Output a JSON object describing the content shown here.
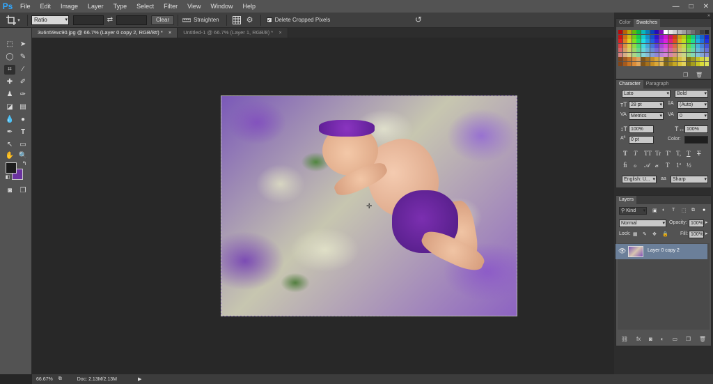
{
  "app": {
    "logo": "Ps"
  },
  "menu": [
    "File",
    "Edit",
    "Image",
    "Layer",
    "Type",
    "Select",
    "Filter",
    "View",
    "Window",
    "Help"
  ],
  "window_controls": {
    "minimize": "—",
    "maximize": "□",
    "close": "✕"
  },
  "options": {
    "tool_icon": "crop-icon",
    "ratio": "Ratio",
    "clear": "Clear",
    "straighten": "Straighten",
    "delete_cropped": "Delete Cropped Pixels",
    "delete_cropped_checked": true
  },
  "tabs": [
    {
      "label": "3u6n59wc90.jpg @ 66.7% (Layer 0 copy 2, RGB/8#) *",
      "active": true
    },
    {
      "label": "Untitled-1 @ 66.7% (Layer 1, RGB/8) *",
      "active": false
    }
  ],
  "swatches_panel": {
    "tabs": [
      "Color",
      "Swatches"
    ],
    "active_tab": "Swatches"
  },
  "character_panel": {
    "tabs": [
      "Character",
      "Paragraph"
    ],
    "font_family": "Lato",
    "font_style": "Bold",
    "size": "28 pt",
    "leading": "(Auto)",
    "kerning": "Metrics",
    "tracking": "0",
    "vscale": "100%",
    "hscale": "100%",
    "baseline": "0 pt",
    "color_label": "Color:",
    "language": "English: U...",
    "aa_label": "aa",
    "antialias": "Sharp",
    "style_buttons": [
      "T",
      "T",
      "TT",
      "Tr",
      "T'",
      "T,",
      "T",
      "T"
    ]
  },
  "layers_panel": {
    "tab": "Layers",
    "kind": "Kind",
    "blend_mode": "Normal",
    "opacity_label": "Opacity:",
    "opacity": "100%",
    "lock_label": "Lock:",
    "fill_label": "Fill:",
    "fill": "100%",
    "layers": [
      {
        "name": "Layer 0 copy 2",
        "visible": true,
        "selected": true
      }
    ]
  },
  "status": {
    "zoom": "66.67%",
    "doc": "Doc: 2.13M/2.13M"
  },
  "colors": {
    "foreground": "#1d1d1d",
    "background": "#6c33a0",
    "accent": "#31a8ff"
  }
}
